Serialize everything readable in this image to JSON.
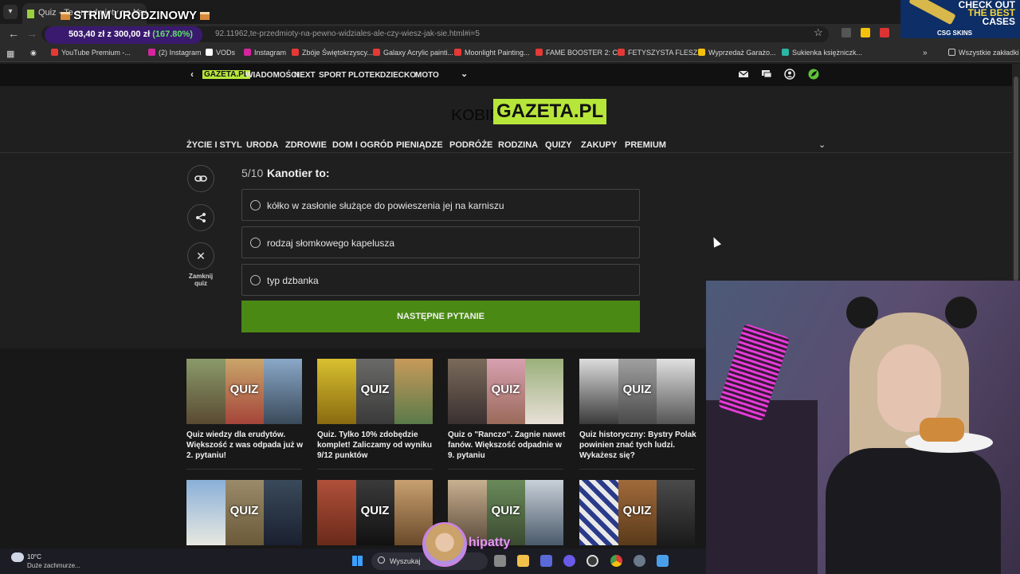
{
  "browser": {
    "tab_title": "Quiz - Te przedmioty na pewno",
    "url": "92.11962,te-przedmioty-na-pewno-widziales-ale-czy-wiesz-jak-sie.html#i=5",
    "bookmarks": [
      {
        "label": "YouTube Premium -...",
        "color": "#e53935"
      },
      {
        "label": "(2) Instagram",
        "color": "#d6249f"
      },
      {
        "label": "VODs",
        "color": "#ffffff"
      },
      {
        "label": "Instagram",
        "color": "#d6249f"
      },
      {
        "label": "Zbóje Świętokrzyscy...",
        "color": "#e53935"
      },
      {
        "label": "Galaxy Acrylic painti...",
        "color": "#e53935"
      },
      {
        "label": "Moonlight Painting...",
        "color": "#e53935"
      },
      {
        "label": "FAME BOOSTER 2: C...",
        "color": "#e53935"
      },
      {
        "label": "FETYSZYSTA FLESZ...",
        "color": "#e53935"
      },
      {
        "label": "Wyprzedaż Garażo...",
        "color": "#f4c20d"
      },
      {
        "label": "Sukienka księżniczk...",
        "color": "#2bb5a5"
      }
    ],
    "all_bookmarks": "Wszystkie zakładki"
  },
  "overlay": {
    "strim_title": "STRIM URODZINOWY",
    "donation_amount": "503,40 zł z 300,00 zł",
    "donation_percent": "(167.80%)",
    "ad_lines": [
      "CHECK OUT",
      "THE BEST",
      "CASES"
    ],
    "ad_brand": "CSG SKINS",
    "streamer_name": "hipatty"
  },
  "site": {
    "brand_small": "GAZETA.PL",
    "top_nav": [
      "WIADOMOŚCI",
      "NEXT",
      "SPORT",
      "PLOTEK",
      "DZIECKO",
      "MOTO"
    ],
    "logo_prefix": "KOBIETA",
    "logo_main": "GAZETA.PL",
    "categories": [
      "ŻYCIE I STYL",
      "URODA",
      "ZDROWIE",
      "DOM I OGRÓD",
      "PIENIĄDZE",
      "PODRÓŻE",
      "RODZINA",
      "QUIZY",
      "ZAKUPY",
      "PREMIUM"
    ]
  },
  "quiz": {
    "counter": "5/10",
    "question": "Kanotier to:",
    "answers": [
      "kółko w zasłonie służące do powieszenia jej na karniszu",
      "rodzaj słomkowego kapelusza",
      "typ dzbanka"
    ],
    "next_label": "NASTĘPNE PYTANIE",
    "close_label": "Zamknij quiz"
  },
  "related": {
    "badge": "QUIZ",
    "cards": [
      {
        "title": "Quiz wiedzy dla erudytów. Większość z was odpada już w 2. pytaniu!"
      },
      {
        "title": "Quiz. Tylko 10% zdobędzie komplet! Zaliczamy od wyniku 9/12 punktów"
      },
      {
        "title": "Quiz o \"Ranczo\". Zagnie nawet fanów. Większość odpadnie w 9. pytaniu"
      },
      {
        "title": "Quiz historyczny: Bystry Polak powinien znać tych ludzi. Wykażesz się?"
      }
    ]
  },
  "taskbar": {
    "temperature": "10°C",
    "weather": "Duże zachmurze...",
    "search_placeholder": "Wyszukaj"
  }
}
